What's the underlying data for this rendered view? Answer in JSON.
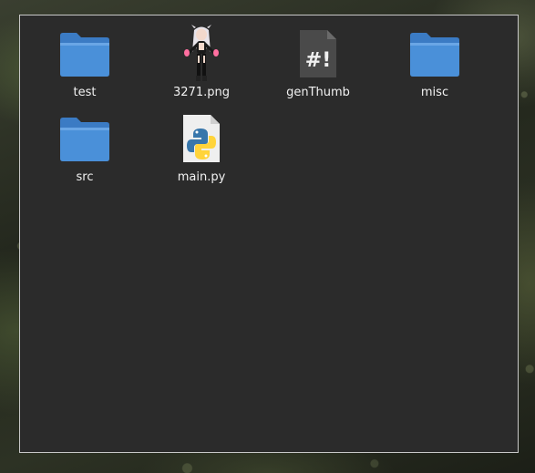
{
  "window": {
    "items": [
      {
        "label": "test",
        "icon": "folder-icon"
      },
      {
        "label": "3271.png",
        "icon": "image-thumbnail-icon"
      },
      {
        "label": "genThumb",
        "icon": "shell-script-icon",
        "glyph": "#!"
      },
      {
        "label": "misc",
        "icon": "folder-icon"
      },
      {
        "label": "src",
        "icon": "folder-icon"
      },
      {
        "label": "main.py",
        "icon": "python-file-icon"
      }
    ]
  },
  "colors": {
    "folder": "#4a90d9",
    "folder_dark": "#3b7bc4",
    "window_bg": "#2b2b2b",
    "window_border": "#c8c8c8",
    "label_text": "#f2f2f2",
    "python_blue": "#3776ab",
    "python_yellow": "#ffd43b"
  }
}
